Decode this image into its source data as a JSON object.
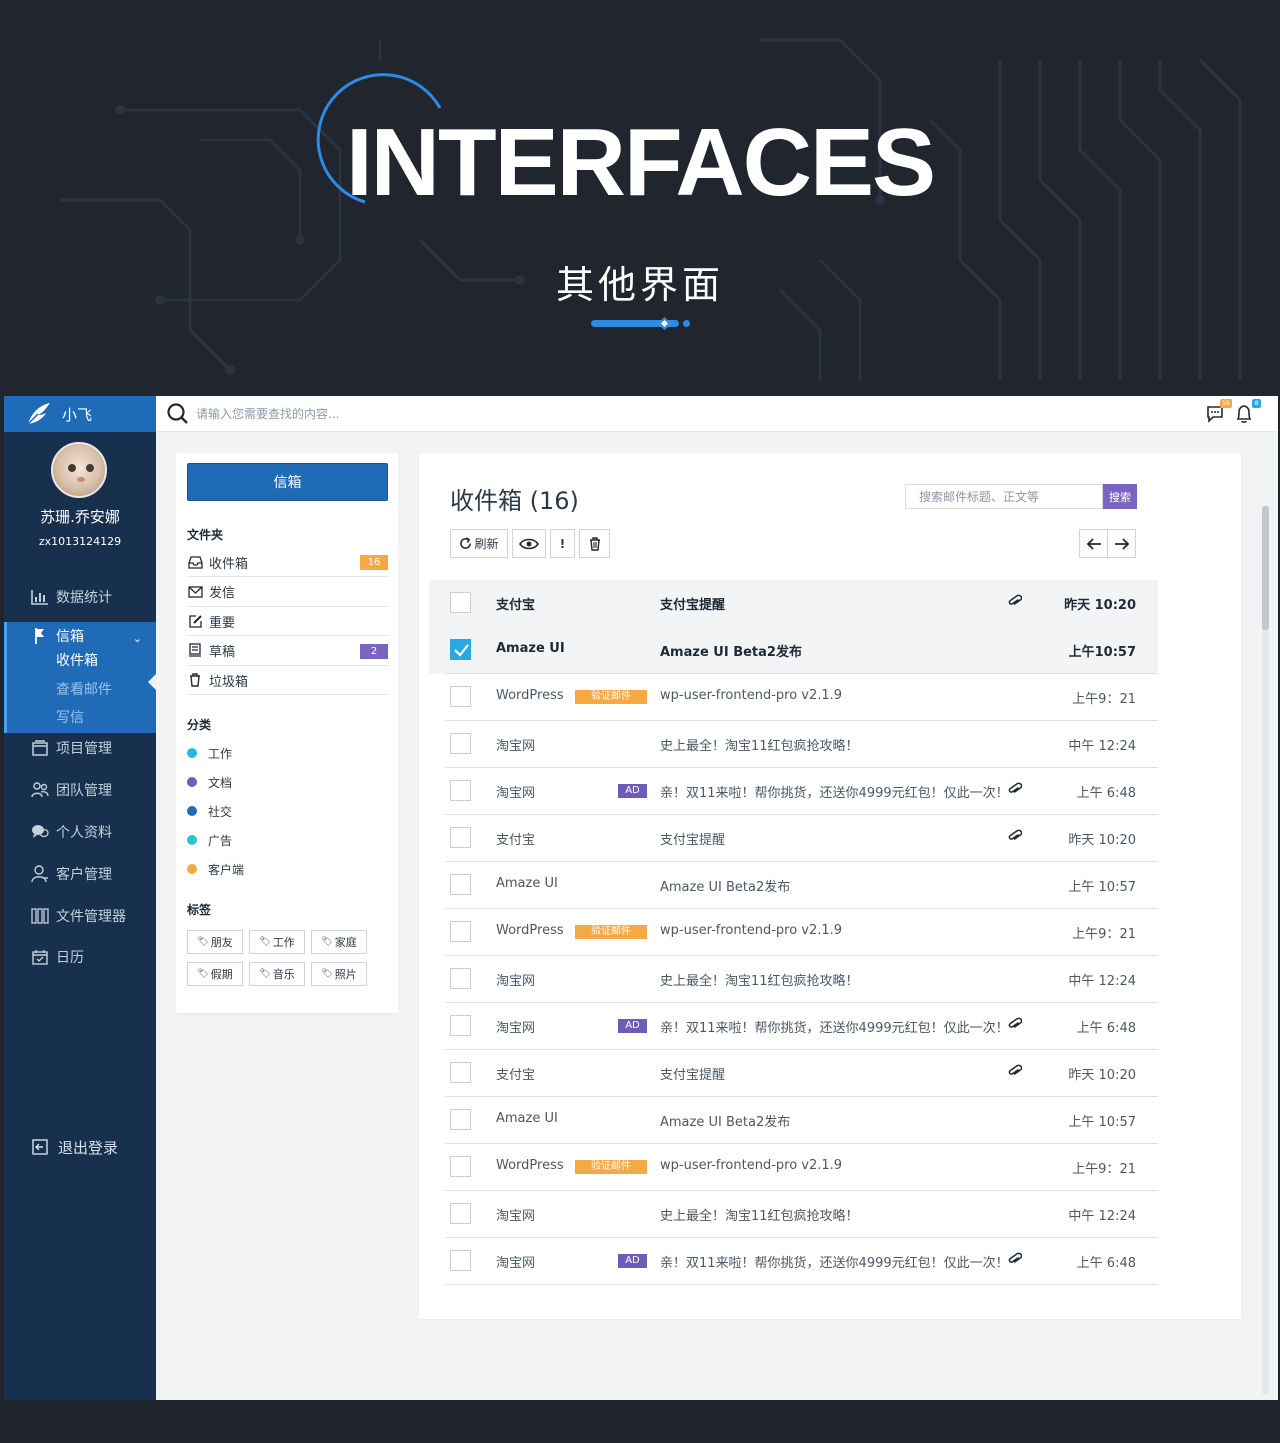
{
  "hero": {
    "title": "INTERFACES",
    "subtitle": "其他界面"
  },
  "app": {
    "brand": "小飞",
    "user": {
      "name": "苏珊.乔安娜",
      "id": "zx1013124129"
    },
    "nav": [
      {
        "label": "数据统计",
        "icon": "bar-chart-icon"
      },
      {
        "label": "信箱",
        "icon": "mail-flag-icon",
        "active": true,
        "sub": [
          "收件箱",
          "查看邮件",
          "写信"
        ]
      },
      {
        "label": "项目管理",
        "icon": "project-icon"
      },
      {
        "label": "团队管理",
        "icon": "team-icon"
      },
      {
        "label": "个人资料",
        "icon": "chat-bubbles-icon"
      },
      {
        "label": "客户管理",
        "icon": "user-icon"
      },
      {
        "label": "文件管理器",
        "icon": "files-icon"
      },
      {
        "label": "日历",
        "icon": "calendar-icon"
      }
    ],
    "logout": "退出登录",
    "search_placeholder": "请输入您需要查找的内容...",
    "top_badges": {
      "messages": "16",
      "notifications": "8"
    },
    "colors": {
      "brand": "#1f6bb8",
      "sidebar": "#17304d",
      "orange": "#f4a942",
      "purple": "#7b63c0",
      "check": "#29a8e4"
    }
  },
  "folders": {
    "compose": "信箱",
    "folder_title": "文件夹",
    "items": [
      {
        "label": "收件箱",
        "icon": "inbox-icon",
        "count": "16",
        "count_color": "#f4a942"
      },
      {
        "label": "发信",
        "icon": "envelope-icon",
        "count": ""
      },
      {
        "label": "重要",
        "icon": "edit-icon",
        "count": ""
      },
      {
        "label": "草稿",
        "icon": "draft-icon",
        "count": "2",
        "count_color": "#7b63c0"
      },
      {
        "label": "垃圾箱",
        "icon": "trash-icon",
        "count": ""
      }
    ],
    "category_title": "分类",
    "categories": [
      {
        "label": "工作",
        "color": "#29b6e0"
      },
      {
        "label": "文档",
        "color": "#6f5bb8"
      },
      {
        "label": "社交",
        "color": "#1f6bb8"
      },
      {
        "label": "广告",
        "color": "#2ec0d0"
      },
      {
        "label": "客户端",
        "color": "#f4a942"
      }
    ],
    "tag_title": "标签",
    "tags": [
      "朋友",
      "工作",
      "家庭",
      "假期",
      "音乐",
      "照片"
    ]
  },
  "mail": {
    "title": "收件箱 (16)",
    "search_placeholder": "搜索邮件标题、正文等",
    "search_btn": "搜索",
    "refresh": "刷新",
    "important": "!",
    "rows": [
      {
        "sender": "支付宝",
        "subject": "支付宝提醒",
        "time": "昨天 10:20",
        "attach": true,
        "label": "",
        "checked": false,
        "bold": true,
        "highlight": true
      },
      {
        "sender": "Amaze UI",
        "subject": "Amaze UI Beta2发布",
        "time": "上午10:57",
        "attach": false,
        "label": "",
        "checked": true,
        "bold": true,
        "highlight": true
      },
      {
        "sender": "WordPress",
        "subject": "wp-user-frontend-pro v2.1.9",
        "time": "上午9：21",
        "attach": false,
        "label": "验证邮件",
        "label_type": "verify",
        "checked": false
      },
      {
        "sender": "淘宝网",
        "subject": "史上最全！淘宝11红包疯抢攻略！",
        "time": "中午 12:24",
        "attach": false,
        "label": "",
        "checked": false
      },
      {
        "sender": "淘宝网",
        "subject": "亲！双11来啦！帮你挑货，还送你4999元红包！仅此一次！",
        "time": "上午 6:48",
        "attach": true,
        "label": "AD",
        "label_type": "ad",
        "checked": false
      },
      {
        "sender": "支付宝",
        "subject": "支付宝提醒",
        "time": "昨天 10:20",
        "attach": true,
        "label": "",
        "checked": false
      },
      {
        "sender": " Amaze UI",
        "subject": " Amaze UI Beta2发布",
        "time": "上午 10:57",
        "attach": false,
        "label": "",
        "checked": false
      },
      {
        "sender": "WordPress",
        "subject": "wp-user-frontend-pro v2.1.9",
        "time": "上午9：21",
        "attach": false,
        "label": "验证邮件",
        "label_type": "verify",
        "checked": false
      },
      {
        "sender": "淘宝网",
        "subject": "史上最全！淘宝11红包疯抢攻略！",
        "time": "中午 12:24",
        "attach": false,
        "label": "",
        "checked": false
      },
      {
        "sender": "淘宝网",
        "subject": "亲！双11来啦！帮你挑货，还送你4999元红包！仅此一次！",
        "time": "上午 6:48",
        "attach": true,
        "label": "AD",
        "label_type": "ad",
        "checked": false
      },
      {
        "sender": "支付宝",
        "subject": "支付宝提醒",
        "time": "昨天 10:20",
        "attach": true,
        "label": "",
        "checked": false
      },
      {
        "sender": " Amaze UI",
        "subject": " Amaze UI Beta2发布",
        "time": "上午 10:57",
        "attach": false,
        "label": "",
        "checked": false
      },
      {
        "sender": "WordPress",
        "subject": "wp-user-frontend-pro v2.1.9",
        "time": "上午9：21",
        "attach": false,
        "label": "验证邮件",
        "label_type": "verify",
        "checked": false
      },
      {
        "sender": "淘宝网",
        "subject": "史上最全！淘宝11红包疯抢攻略！",
        "time": "中午 12:24",
        "attach": false,
        "label": "",
        "checked": false
      },
      {
        "sender": "淘宝网",
        "subject": "亲！双11来啦！帮你挑货，还送你4999元红包！仅此一次！",
        "time": "上午 6:48",
        "attach": true,
        "label": "AD",
        "label_type": "ad",
        "checked": false
      }
    ]
  }
}
